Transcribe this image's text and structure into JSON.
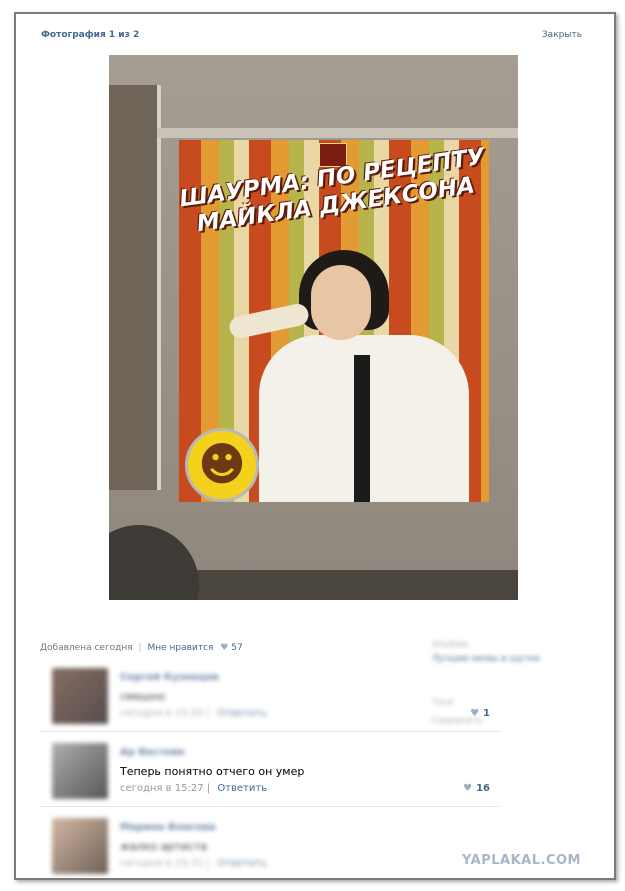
{
  "header": {
    "counter": "Фотография 1 из 2",
    "close": "Закрыть"
  },
  "photo": {
    "poster_title_line1": "ШАУРМА: ПО РЕЦЕПТУ",
    "poster_title_line2": "МАЙКЛА ДЖЕКСОНА",
    "smiley": "☻"
  },
  "meta": {
    "added": "Добавлена сегодня",
    "like_label": "Мне нравится",
    "like_icon": "♥",
    "like_count": "57"
  },
  "sidebar": {
    "album_label": "Альбом:",
    "album_name": "Лучшие мемы и шутки",
    "items": [
      "Тэги",
      "Сохранить"
    ]
  },
  "comments": [
    {
      "author": "Сергей Кузнецов",
      "text": "смешно",
      "date": "сегодня в 15:20",
      "reply": "Ответить",
      "likes": "1",
      "heart": "♥"
    },
    {
      "author": "Ар Вестник",
      "text": "Теперь понятно отчего он умер",
      "date": "сегодня в 15:27",
      "reply": "Ответить",
      "likes": "16",
      "heart": "♥"
    },
    {
      "author": "Марина Власова",
      "text": "жалко артиста",
      "date": "сегодня в 15:31",
      "reply": "Ответить"
    }
  ],
  "watermark": "YAPLAKAL.COM"
}
